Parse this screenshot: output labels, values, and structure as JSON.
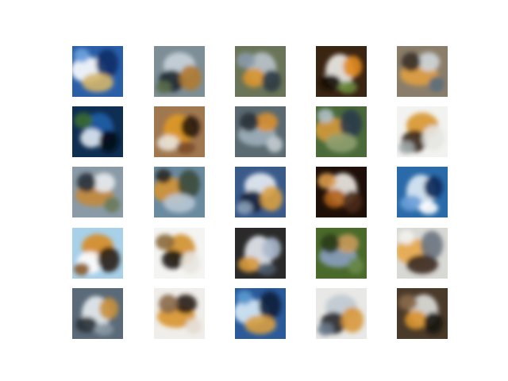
{
  "figure": {
    "background": "#ffffff",
    "rows": 5,
    "cols": 5
  },
  "tiles": [
    {
      "bg": "#2a5fa8",
      "blobs": [
        {
          "c": "#ffffff"
        },
        {
          "c": "#0b2d66"
        },
        {
          "c": "#d4b56a"
        },
        {
          "c": "#6fa3e0"
        }
      ]
    },
    {
      "bg": "#7d8e96",
      "blobs": [
        {
          "c": "#c9d3da"
        },
        {
          "c": "#1e2a30"
        },
        {
          "c": "#b07a30"
        },
        {
          "c": "#5a6e4a"
        }
      ]
    },
    {
      "bg": "#6a7458",
      "blobs": [
        {
          "c": "#b9c4cc"
        },
        {
          "c": "#d9952c"
        },
        {
          "c": "#2c3a44"
        },
        {
          "c": "#8a9aa8"
        }
      ]
    },
    {
      "bg": "#3a2412",
      "blobs": [
        {
          "c": "#f0f0ea"
        },
        {
          "c": "#e08a1c"
        },
        {
          "c": "#140c06"
        },
        {
          "c": "#6a8a3c"
        }
      ]
    },
    {
      "bg": "#8a7e6a",
      "blobs": [
        {
          "c": "#e0a040"
        },
        {
          "c": "#cfd6da"
        },
        {
          "c": "#3a3028"
        },
        {
          "c": "#5c6e7a"
        }
      ]
    },
    {
      "bg": "#0e2e52",
      "blobs": [
        {
          "c": "#1e5ea8"
        },
        {
          "c": "#dfe8f0"
        },
        {
          "c": "#050a14"
        },
        {
          "c": "#3a6a30"
        }
      ]
    },
    {
      "bg": "#a07850",
      "blobs": [
        {
          "c": "#e09a24"
        },
        {
          "c": "#2a1a10"
        },
        {
          "c": "#e8e4dc"
        },
        {
          "c": "#7a4a2a"
        }
      ]
    },
    {
      "bg": "#5a6a70",
      "blobs": [
        {
          "c": "#9fb0bc"
        },
        {
          "c": "#d89030"
        },
        {
          "c": "#2a3238"
        },
        {
          "c": "#c4ccd0"
        }
      ]
    },
    {
      "bg": "#4a6a3a",
      "blobs": [
        {
          "c": "#d49a3a"
        },
        {
          "c": "#2a3a4a"
        },
        {
          "c": "#90a070"
        },
        {
          "c": "#b0c0c8"
        }
      ]
    },
    {
      "bg": "#f2f2f0",
      "blobs": [
        {
          "c": "#d8962c"
        },
        {
          "c": "#3a2a18"
        },
        {
          "c": "#e6e6e2"
        },
        {
          "c": "#a0a8a8"
        }
      ]
    },
    {
      "bg": "#8a9aa6",
      "blobs": [
        {
          "c": "#c48a3a"
        },
        {
          "c": "#e8ecf0"
        },
        {
          "c": "#2a323a"
        },
        {
          "c": "#6a7a5a"
        }
      ]
    },
    {
      "bg": "#6a8aa0",
      "blobs": [
        {
          "c": "#d49434"
        },
        {
          "c": "#3a4a3a"
        },
        {
          "c": "#b8c8d4"
        },
        {
          "c": "#2a2a22"
        }
      ]
    },
    {
      "bg": "#3a5a8a",
      "blobs": [
        {
          "c": "#e8eef4"
        },
        {
          "c": "#14243a"
        },
        {
          "c": "#d8a040"
        },
        {
          "c": "#8aa0b8"
        }
      ]
    },
    {
      "bg": "#1e1008",
      "blobs": [
        {
          "c": "#f0ece6"
        },
        {
          "c": "#b0601a"
        },
        {
          "c": "#4a2a14"
        },
        {
          "c": "#d89a4a"
        }
      ]
    },
    {
      "bg": "#2a6aa8",
      "blobs": [
        {
          "c": "#e0ecf6"
        },
        {
          "c": "#0a2a5a"
        },
        {
          "c": "#6aa0d8"
        },
        {
          "c": "#ffffff"
        }
      ]
    },
    {
      "bg": "#a8d0e8",
      "blobs": [
        {
          "c": "#d88c24"
        },
        {
          "c": "#ffffff"
        },
        {
          "c": "#2a2014"
        },
        {
          "c": "#8a5a2a"
        }
      ]
    },
    {
      "bg": "#f4f4f2",
      "blobs": [
        {
          "c": "#d0902c"
        },
        {
          "c": "#1e1a14"
        },
        {
          "c": "#e8e6e0"
        },
        {
          "c": "#8a6a3a"
        }
      ]
    },
    {
      "bg": "#2a2a2a",
      "blobs": [
        {
          "c": "#e8ecf2"
        },
        {
          "c": "#a8b8cc"
        },
        {
          "c": "#d89a3a"
        },
        {
          "c": "#4a5a6a"
        }
      ]
    },
    {
      "bg": "#4a6a2a",
      "blobs": [
        {
          "c": "#8aa0c0"
        },
        {
          "c": "#c89a5a"
        },
        {
          "c": "#2a3a1a"
        },
        {
          "c": "#6a8a4a"
        }
      ]
    },
    {
      "bg": "#d8d8d4",
      "blobs": [
        {
          "c": "#e8a84a"
        },
        {
          "c": "#6a7480"
        },
        {
          "c": "#3a2a1e"
        },
        {
          "c": "#f2f2f0"
        }
      ]
    },
    {
      "bg": "#5a6a78",
      "blobs": [
        {
          "c": "#e8eef2"
        },
        {
          "c": "#c8903a"
        },
        {
          "c": "#2a3238"
        },
        {
          "c": "#8a98a4"
        }
      ]
    },
    {
      "bg": "#f0eeea",
      "blobs": [
        {
          "c": "#d8942c"
        },
        {
          "c": "#2a1e14"
        },
        {
          "c": "#8a6a4a"
        },
        {
          "c": "#e4dcd0"
        }
      ]
    },
    {
      "bg": "#2a5a9a",
      "blobs": [
        {
          "c": "#d8ecf8"
        },
        {
          "c": "#0a1e3a"
        },
        {
          "c": "#d8a040"
        },
        {
          "c": "#5a9ad0"
        }
      ]
    },
    {
      "bg": "#e8e8e6",
      "blobs": [
        {
          "c": "#c0cad2"
        },
        {
          "c": "#2a2a2e"
        },
        {
          "c": "#d8983a"
        },
        {
          "c": "#6a7a8a"
        }
      ]
    },
    {
      "bg": "#4a3a2a",
      "blobs": [
        {
          "c": "#e0e0dc"
        },
        {
          "c": "#d8942c"
        },
        {
          "c": "#1a140e"
        },
        {
          "c": "#8a6a4a"
        }
      ]
    }
  ]
}
